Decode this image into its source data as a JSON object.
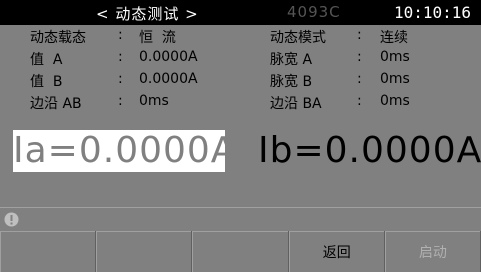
{
  "header": {
    "title": "< 动态测试 >",
    "model": "4093C",
    "time": "10:10:16"
  },
  "params": {
    "left": [
      {
        "label": "动态载态",
        "sep": ":",
        "value": "恒  流"
      },
      {
        "label": "值  A",
        "sep": ":",
        "value": "0.0000A"
      },
      {
        "label": "值  B",
        "sep": ":",
        "value": "0.0000A"
      },
      {
        "label": "边沿 AB",
        "sep": ":",
        "value": "0ms"
      }
    ],
    "right": [
      {
        "label": "动态模式",
        "sep": ":",
        "value": "连续"
      },
      {
        "label": "脉宽 A",
        "sep": ":",
        "value": "0ms"
      },
      {
        "label": "脉宽 B",
        "sep": ":",
        "value": "0ms"
      },
      {
        "label": "边沿 BA",
        "sep": ":",
        "value": "0ms"
      }
    ]
  },
  "readouts": {
    "ia": "Ia=0.0000A",
    "ib": "Ib=0.0000A"
  },
  "softkeys": [
    {
      "label": ""
    },
    {
      "label": ""
    },
    {
      "label": ""
    },
    {
      "label": "返回"
    },
    {
      "label": "启动"
    }
  ],
  "colors": {
    "background": "#808080",
    "topbar": "#000000",
    "highlight": "#ffffff"
  }
}
